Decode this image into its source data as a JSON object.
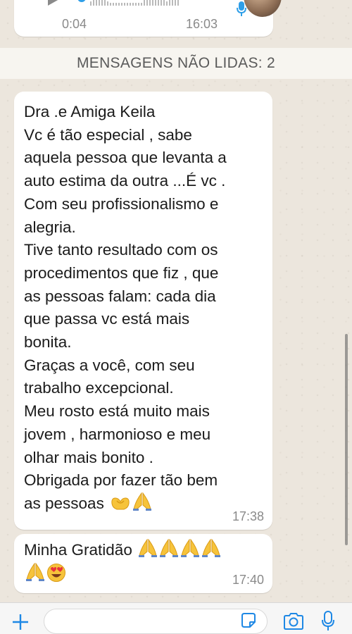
{
  "voice_message": {
    "duration": "0:04",
    "time": "16:03",
    "icons": [
      "play-icon",
      "microphone-icon",
      "avatar"
    ]
  },
  "unread_banner": "MENSAGENS NÃO LIDAS: 2",
  "messages": [
    {
      "text": "Dra .e Amiga Keila\nVc é  tão especial , sabe\naquela pessoa que levanta a\nauto estima da outra ...É  vc .\nCom seu profissionalismo e\nalegria.\nTive tanto resultado com os\nprocedimentos que fiz , que\nas pessoas falam: cada dia\nque passa vc está mais\nbonita.\nGraças a você,  com seu\ntrabalho excepcional.\nMeu rosto está muito mais\njovem , harmonioso e meu\nolhar mais bonito .\nObrigada por fazer tão bem\nas pessoas",
      "emojis": [
        "heart-hands-emoji",
        "folded-hands-emoji"
      ],
      "time": "17:38"
    },
    {
      "text": "Minha Gratidão",
      "emojis_line1": [
        "folded-hands-emoji",
        "folded-hands-emoji",
        "folded-hands-emoji",
        "folded-hands-emoji"
      ],
      "emojis_line2": [
        "folded-hands-emoji",
        "heart-eyes-emoji"
      ],
      "time": "17:40"
    }
  ],
  "input_bar": {
    "icons": [
      "plus-icon",
      "sticker-icon",
      "camera-icon",
      "microphone-icon"
    ],
    "accent_color": "#1e88e5"
  }
}
